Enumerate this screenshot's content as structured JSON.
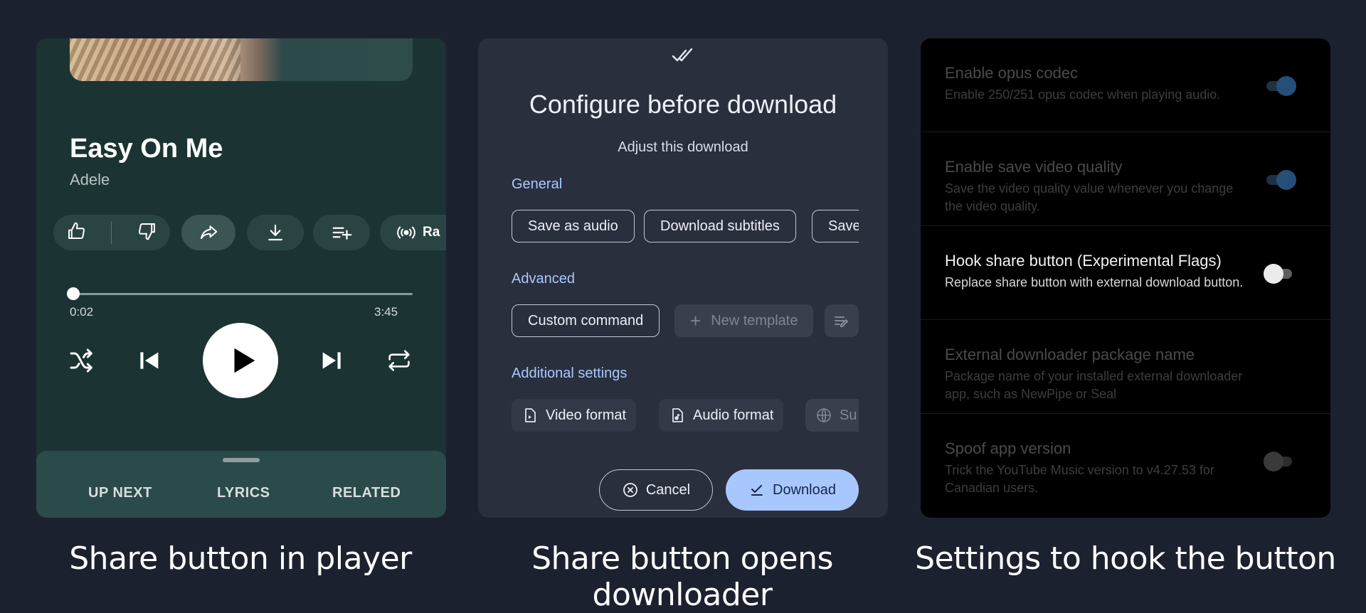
{
  "player": {
    "song_title": "Easy On Me",
    "artist": "Adele",
    "radio_label": "Ra",
    "current_time": "0:02",
    "total_time": "3:45",
    "progress": 0.009,
    "tabs": [
      "UP NEXT",
      "LYRICS",
      "RELATED"
    ]
  },
  "downloader": {
    "title": "Configure before download",
    "subtitle": "Adjust this download",
    "general_label": "General",
    "general_chips": [
      "Save as audio",
      "Download subtitles",
      "Save"
    ],
    "advanced_label": "Advanced",
    "advanced_chips": [
      "Custom command",
      "New template"
    ],
    "additional_label": "Additional settings",
    "additional_chips": [
      "Video format",
      "Audio format",
      "Su"
    ],
    "cancel_label": "Cancel",
    "download_label": "Download"
  },
  "settings": {
    "items": [
      {
        "title": "Enable opus codec",
        "desc": "Enable 250/251 opus codec when playing audio.",
        "enabled": true
      },
      {
        "title": "Enable save video quality",
        "desc": "Save the video quality value whenever you change the video quality.",
        "enabled": true
      },
      {
        "title": "Hook share button (Experimental Flags)",
        "desc": "Replace share button with external download button.",
        "enabled": false
      },
      {
        "title": "External downloader package name",
        "desc": "Package name of your installed external downloader app, such as NewPipe or Seal"
      },
      {
        "title": "Spoof app version",
        "desc": "Trick the YouTube Music version to v4.27.53 for Canadian users.",
        "enabled": false
      }
    ]
  },
  "captions": {
    "player": "Share button in player",
    "downloader": "Share button opens downloader",
    "settings": "Settings to hook the button"
  },
  "colors": {
    "background": "#1c2130",
    "player_bg": "#1b3333",
    "downloader_bg": "#2a2f3e",
    "accent_blue": "#a9c7ff",
    "settings_bg": "#000000"
  }
}
